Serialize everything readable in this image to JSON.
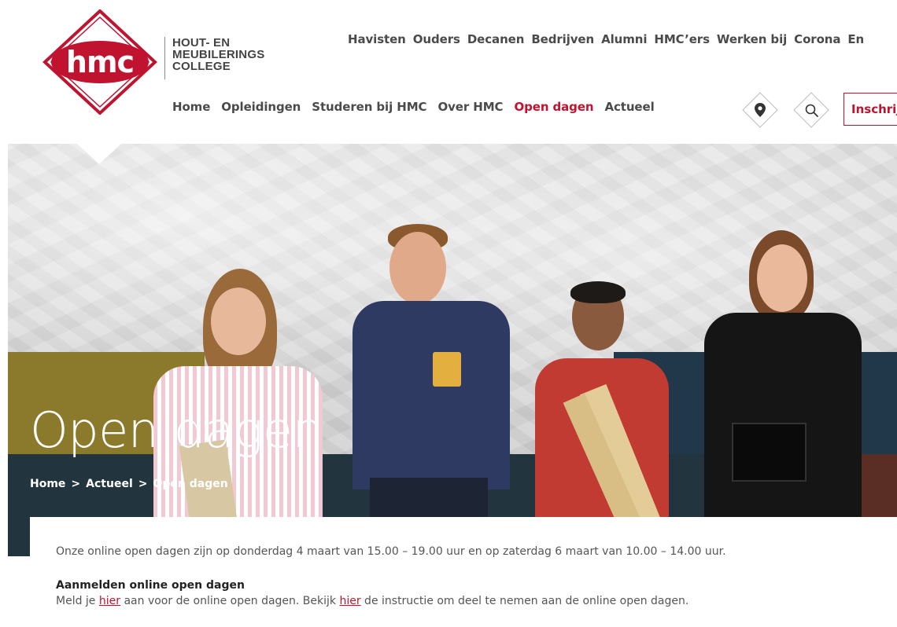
{
  "header": {
    "logo_text": "hmc",
    "college_name": [
      "HOUT- EN",
      "MEUBILERINGS",
      "COLLEGE"
    ],
    "top_nav": [
      "Havisten",
      "Ouders",
      "Decanen",
      "Bedrijven",
      "Alumni",
      "HMC’ers",
      "Werken bij",
      "Corona",
      "En"
    ],
    "main_nav": [
      {
        "label": "Home",
        "active": false
      },
      {
        "label": "Opleidingen",
        "active": false
      },
      {
        "label": "Studeren bij HMC",
        "active": false
      },
      {
        "label": "Over HMC",
        "active": false
      },
      {
        "label": "Open dagen",
        "active": true
      },
      {
        "label": "Actueel",
        "active": false
      }
    ],
    "location_icon": "map-pin-icon",
    "search_icon": "search-icon",
    "register_label": "Inschrijven"
  },
  "hero": {
    "title": "Open dagen",
    "breadcrumb": [
      "Home",
      "Actueel",
      "Open dagen"
    ],
    "breadcrumb_separator": ">"
  },
  "content": {
    "intro": "Onze online open dagen zijn op donderdag 4 maart van 15.00 – 19.00 uur en op zaterdag 6 maart van 10.00 – 14.00 uur.",
    "heading": "Aanmelden online open dagen",
    "text_part1": "Meld je ",
    "link1": "hier",
    "text_part2": " aan voor de online open dagen. Bekijk ",
    "link2": "hier",
    "text_part3": " de instructie om deel te nemen aan de online open dagen."
  },
  "colors": {
    "brand_red": "#c0132f",
    "nav_text": "#4a4a4a",
    "dark_band": "#22343d"
  }
}
